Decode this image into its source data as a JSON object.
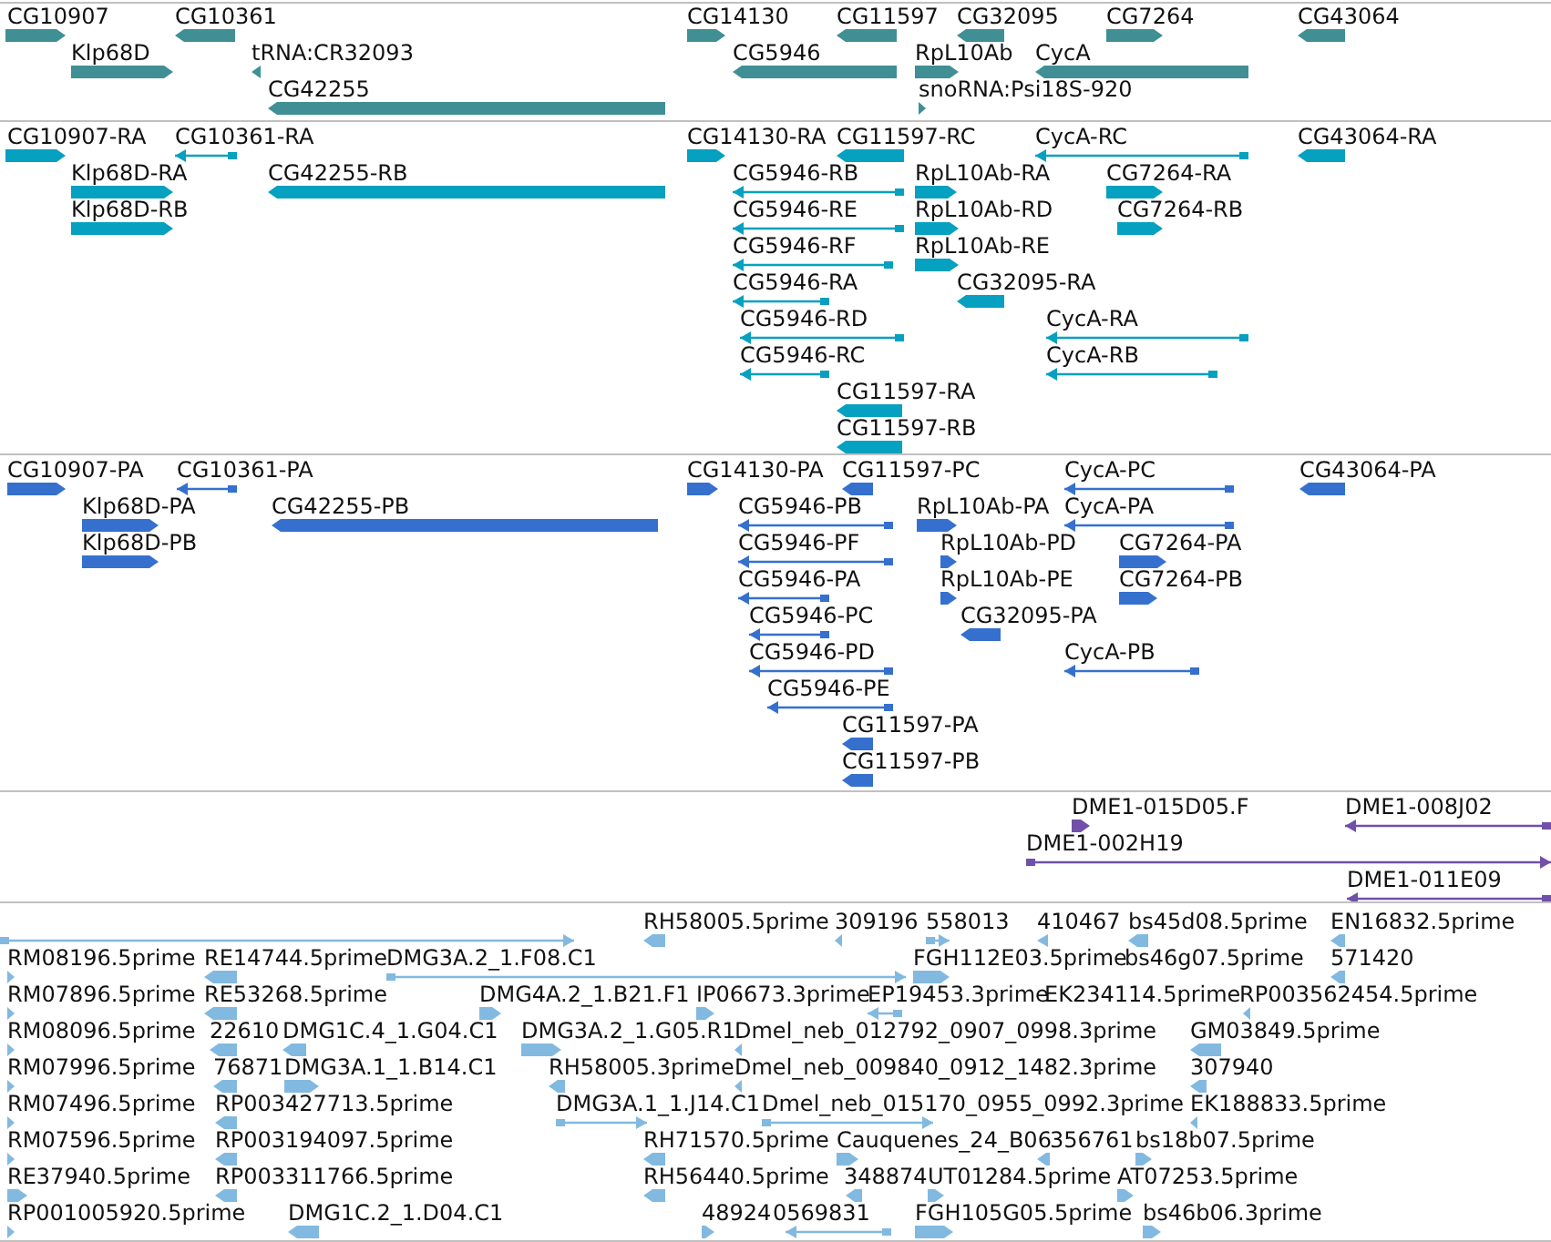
{
  "tracks": [
    {
      "kind": "gene",
      "features": [
        {
          "label": "CG10907",
          "reverse": false
        },
        {
          "label": "CG10361",
          "reverse": true
        },
        {
          "label": "CG14130",
          "reverse": false
        },
        {
          "label": "CG11597",
          "reverse": true
        },
        {
          "label": "CG32095",
          "reverse": true
        },
        {
          "label": "CG7264",
          "reverse": false
        },
        {
          "label": "CG43064",
          "reverse": true
        },
        {
          "label": "Klp68D",
          "reverse": false
        },
        {
          "label": "tRNA:CR32093",
          "reverse": true
        },
        {
          "label": "CG5946",
          "reverse": true
        },
        {
          "label": "RpL10Ab",
          "reverse": false
        },
        {
          "label": "CycA",
          "reverse": true
        },
        {
          "label": "CG42255",
          "reverse": true
        },
        {
          "label": "snoRNA:Psi18S-920",
          "reverse": false
        }
      ]
    },
    {
      "kind": "transcript",
      "features": [
        {
          "label": "CG10907-RA",
          "reverse": false
        },
        {
          "label": "CG10361-RA",
          "reverse": true
        },
        {
          "label": "CG14130-RA",
          "reverse": false
        },
        {
          "label": "CG11597-RC",
          "reverse": true
        },
        {
          "label": "CycA-RC",
          "reverse": true
        },
        {
          "label": "CG43064-RA",
          "reverse": true
        },
        {
          "label": "Klp68D-RA",
          "reverse": false
        },
        {
          "label": "CG42255-RB",
          "reverse": true
        },
        {
          "label": "CG5946-RB",
          "reverse": true
        },
        {
          "label": "RpL10Ab-RA",
          "reverse": false
        },
        {
          "label": "CG7264-RA",
          "reverse": false
        },
        {
          "label": "Klp68D-RB",
          "reverse": false
        },
        {
          "label": "CG5946-RE",
          "reverse": true
        },
        {
          "label": "RpL10Ab-RD",
          "reverse": false
        },
        {
          "label": "CG7264-RB",
          "reverse": false
        },
        {
          "label": "CG5946-RF",
          "reverse": true
        },
        {
          "label": "RpL10Ab-RE",
          "reverse": false
        },
        {
          "label": "CG5946-RA",
          "reverse": true
        },
        {
          "label": "CG32095-RA",
          "reverse": true
        },
        {
          "label": "CG5946-RD",
          "reverse": true
        },
        {
          "label": "CycA-RA",
          "reverse": true
        },
        {
          "label": "CG5946-RC",
          "reverse": true
        },
        {
          "label": "CycA-RB",
          "reverse": true
        },
        {
          "label": "CG11597-RA",
          "reverse": true
        },
        {
          "label": "CG11597-RB",
          "reverse": true
        }
      ]
    },
    {
      "kind": "protein",
      "features": [
        {
          "label": "CG10907-PA",
          "reverse": false
        },
        {
          "label": "CG10361-PA",
          "reverse": true
        },
        {
          "label": "CG14130-PA",
          "reverse": false
        },
        {
          "label": "CG11597-PC",
          "reverse": true
        },
        {
          "label": "CycA-PC",
          "reverse": true
        },
        {
          "label": "CG43064-PA",
          "reverse": true
        },
        {
          "label": "Klp68D-PA",
          "reverse": false
        },
        {
          "label": "CG42255-PB",
          "reverse": true
        },
        {
          "label": "CG5946-PB",
          "reverse": true
        },
        {
          "label": "RpL10Ab-PA",
          "reverse": false
        },
        {
          "label": "CycA-PA",
          "reverse": true
        },
        {
          "label": "Klp68D-PB",
          "reverse": false
        },
        {
          "label": "CG5946-PF",
          "reverse": true
        },
        {
          "label": "RpL10Ab-PD",
          "reverse": false
        },
        {
          "label": "CG7264-PA",
          "reverse": false
        },
        {
          "label": "CG5946-PA",
          "reverse": true
        },
        {
          "label": "RpL10Ab-PE",
          "reverse": false
        },
        {
          "label": "CG7264-PB",
          "reverse": false
        },
        {
          "label": "CG5946-PC",
          "reverse": true
        },
        {
          "label": "CG32095-PA",
          "reverse": true
        },
        {
          "label": "CG5946-PD",
          "reverse": true
        },
        {
          "label": "CycA-PB",
          "reverse": true
        },
        {
          "label": "CG5946-PE",
          "reverse": true
        },
        {
          "label": "CG11597-PA",
          "reverse": true
        },
        {
          "label": "CG11597-PB",
          "reverse": true
        }
      ]
    },
    {
      "kind": "clone",
      "features": [
        {
          "label": "DME1-015D05.F",
          "reverse": false
        },
        {
          "label": "DME1-008J02",
          "reverse": true
        },
        {
          "label": "DME1-002H19",
          "reverse": false
        },
        {
          "label": "DME1-011E09",
          "reverse": true
        }
      ]
    },
    {
      "kind": "est",
      "features": [
        {
          "reverse": false
        },
        {
          "label": "RH58005.5prime",
          "reverse": true
        },
        {
          "label": "309196",
          "reverse": true
        },
        {
          "label": "558013",
          "reverse": false
        },
        {
          "label": "410467",
          "reverse": true
        },
        {
          "label": "bs45d08.5prime",
          "reverse": true
        },
        {
          "label": "EN16832.5prime",
          "reverse": true
        },
        {
          "label": "RM08196.5prime",
          "reverse": false
        },
        {
          "label": "RE14744.5prime",
          "reverse": true
        },
        {
          "label": "DMG3A.2_1.F08.C1",
          "reverse": false
        },
        {
          "label": "FGH112E03.5prime",
          "reverse": false
        },
        {
          "label": "bs46g07.5prime"
        },
        {
          "label": "571420",
          "reverse": true
        },
        {
          "label": "RM07896.5prime",
          "reverse": false
        },
        {
          "label": "RE53268.5prime",
          "reverse": true
        },
        {
          "label": "DMG4A.2_1.B21.F1",
          "reverse": false
        },
        {
          "label": "IP06673.3prime",
          "reverse": false
        },
        {
          "label": "EP19453.3prime",
          "reverse": true
        },
        {
          "label": "EK234114.5prime"
        },
        {
          "label": "RP003562454.5prime",
          "reverse": true
        },
        {
          "label": "RM08096.5prime",
          "reverse": false
        },
        {
          "label": "22610",
          "reverse": true
        },
        {
          "label": "DMG1C.4_1.G04.C1",
          "reverse": true
        },
        {
          "label": "DMG3A.2_1.G05.R1",
          "reverse": false
        },
        {
          "label": "Dmel_neb_012792_0907_0998.3prime",
          "reverse": true
        },
        {
          "label": "GM03849.5prime",
          "reverse": true
        },
        {
          "label": "RM07996.5prime",
          "reverse": false
        },
        {
          "label": "76871",
          "reverse": true
        },
        {
          "label": "DMG3A.1_1.B14.C1",
          "reverse": false
        },
        {
          "label": "RH58005.3prime",
          "reverse": true
        },
        {
          "label": "Dmel_neb_009840_0912_1482.3prime",
          "reverse": true
        },
        {
          "label": "307940",
          "reverse": true
        },
        {
          "label": "RM07496.5prime",
          "reverse": false
        },
        {
          "label": "RP003427713.5prime",
          "reverse": true
        },
        {
          "label": "DMG3A.1_1.J14.C1",
          "reverse": false
        },
        {
          "label": "Dmel_neb_015170_0955_0992.3prime",
          "reverse": false
        },
        {
          "label": "EK188833.5prime",
          "reverse": true
        },
        {
          "label": "RM07596.5prime",
          "reverse": false
        },
        {
          "label": "RP003194097.5prime",
          "reverse": true
        },
        {
          "label": "RH71570.5prime",
          "reverse": true
        },
        {
          "label": "Cauquenes_24_B06",
          "reverse": false
        },
        {
          "label": "356761",
          "reverse": true
        },
        {
          "label": "bs18b07.5prime",
          "reverse": false
        },
        {
          "label": "RE37940.5prime",
          "reverse": false
        },
        {
          "label": "RP003311766.5prime",
          "reverse": true
        },
        {
          "label": "RH56440.5prime",
          "reverse": true
        },
        {
          "label": "348874",
          "reverse": true
        },
        {
          "label": "UT01284.5prime",
          "reverse": false
        },
        {
          "label": "AT07253.5prime",
          "reverse": false
        },
        {
          "label": "RP001005920.5prime",
          "reverse": false
        },
        {
          "label": "DMG1C.2_1.D04.C1",
          "reverse": true
        },
        {
          "label": "48924",
          "reverse": false
        },
        {
          "label": "0569831",
          "reverse": true
        },
        {
          "label": "FGH105G05.5prime",
          "reverse": false
        },
        {
          "label": "bs46b06.3prime",
          "reverse": false
        }
      ]
    }
  ]
}
